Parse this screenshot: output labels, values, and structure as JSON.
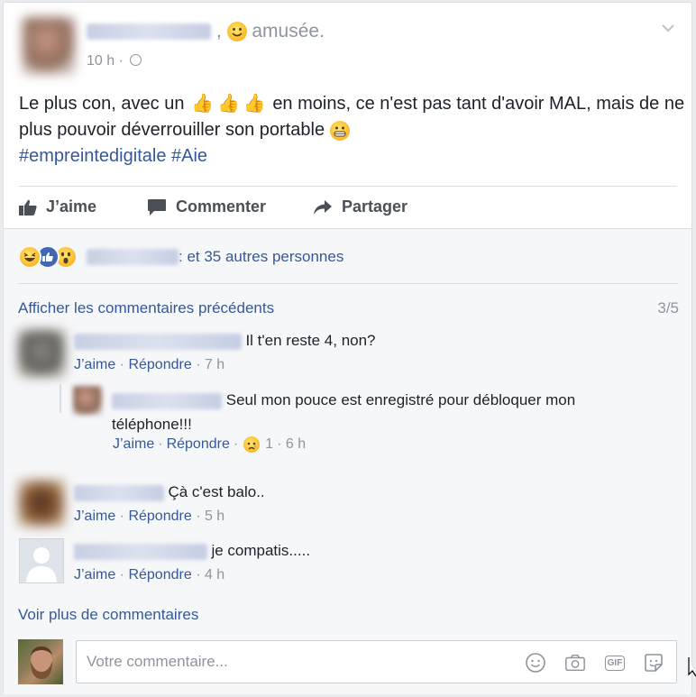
{
  "post": {
    "feeling": "amusée.",
    "time": "10 h ·",
    "text_part1": "Le plus con, avec un",
    "text_part2": "en moins, ce n'est pas tant d'avoir MAL, mais de ne plus pouvoir déverrouiller son portable",
    "hashtag1": "#empreintedigitale",
    "hashtag2": "#Aie"
  },
  "actions": {
    "like": "J’aime",
    "comment": "Commenter",
    "share": "Partager"
  },
  "reactions": {
    "others": ": et 35 autres personnes"
  },
  "comments": {
    "show_previous": "Afficher les commentaires précédents",
    "count": "3/5",
    "list": [
      {
        "text": "Il t'en reste 4, non?",
        "like": "J’aime",
        "reply": "Répondre",
        "time": "· 7 h"
      },
      {
        "text": "Çà c'est balo..",
        "like": "J’aime",
        "reply": "Répondre",
        "time": "· 5 h"
      },
      {
        "text": "je compatis.....",
        "like": "J’aime",
        "reply": "Répondre",
        "time": "· 4 h"
      }
    ],
    "reply": {
      "text": "Seul mon pouce est enregistré pour débloquer mon téléphone!!!",
      "like": "J’aime",
      "reply": "Répondre",
      "reaction_count": "1",
      "time": "· 6 h"
    },
    "see_more": "Voir plus de commentaires"
  },
  "composer": {
    "placeholder": "Votre commentaire...",
    "gif_label": "GIF"
  },
  "colors": {
    "link": "#365899",
    "like_blue": "#4267b2",
    "emoji_yellow": "#f7b928"
  }
}
